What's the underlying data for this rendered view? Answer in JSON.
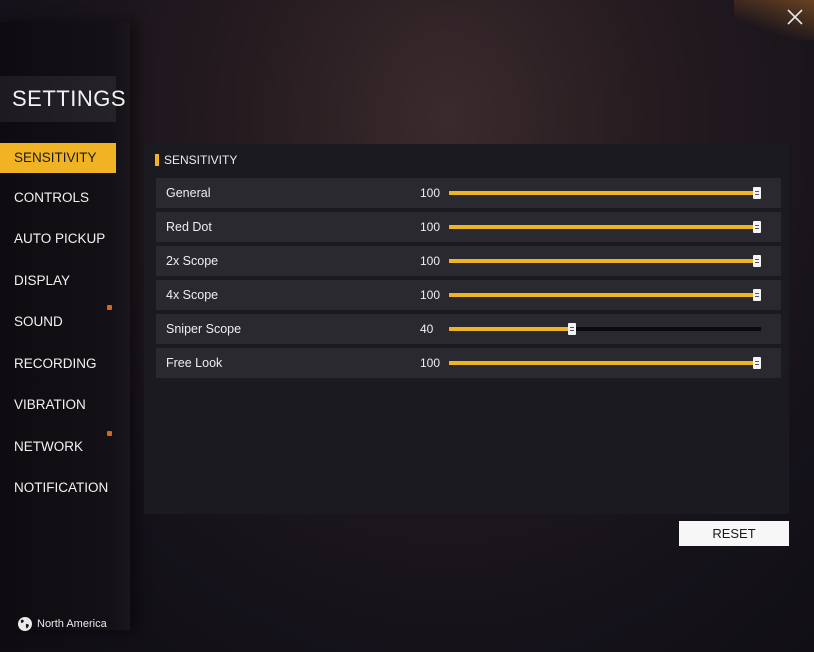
{
  "sidebar": {
    "title": "SETTINGS",
    "items": [
      {
        "label": "SENSITIVITY",
        "active": true
      },
      {
        "label": "CONTROLS"
      },
      {
        "label": "AUTO PICKUP"
      },
      {
        "label": "DISPLAY"
      },
      {
        "label": "SOUND"
      },
      {
        "label": "RECORDING"
      },
      {
        "label": "VIBRATION"
      },
      {
        "label": "NETWORK"
      },
      {
        "label": "NOTIFICATION"
      }
    ],
    "region": "North America"
  },
  "panel": {
    "header": "SENSITIVITY",
    "rows": [
      {
        "label": "General",
        "value": "100",
        "percent": 100
      },
      {
        "label": "Red Dot",
        "value": "100",
        "percent": 100
      },
      {
        "label": "2x Scope",
        "value": "100",
        "percent": 100
      },
      {
        "label": "4x Scope",
        "value": "100",
        "percent": 100
      },
      {
        "label": "Sniper Scope",
        "value": "40",
        "percent": 40
      },
      {
        "label": "Free Look",
        "value": "100",
        "percent": 100
      }
    ]
  },
  "buttons": {
    "reset": "RESET"
  },
  "colors": {
    "accent": "#f0b323",
    "panel": "#1b1a20",
    "row": "#2a292f"
  },
  "icons": {
    "close": "close-icon",
    "globe": "globe-icon"
  }
}
